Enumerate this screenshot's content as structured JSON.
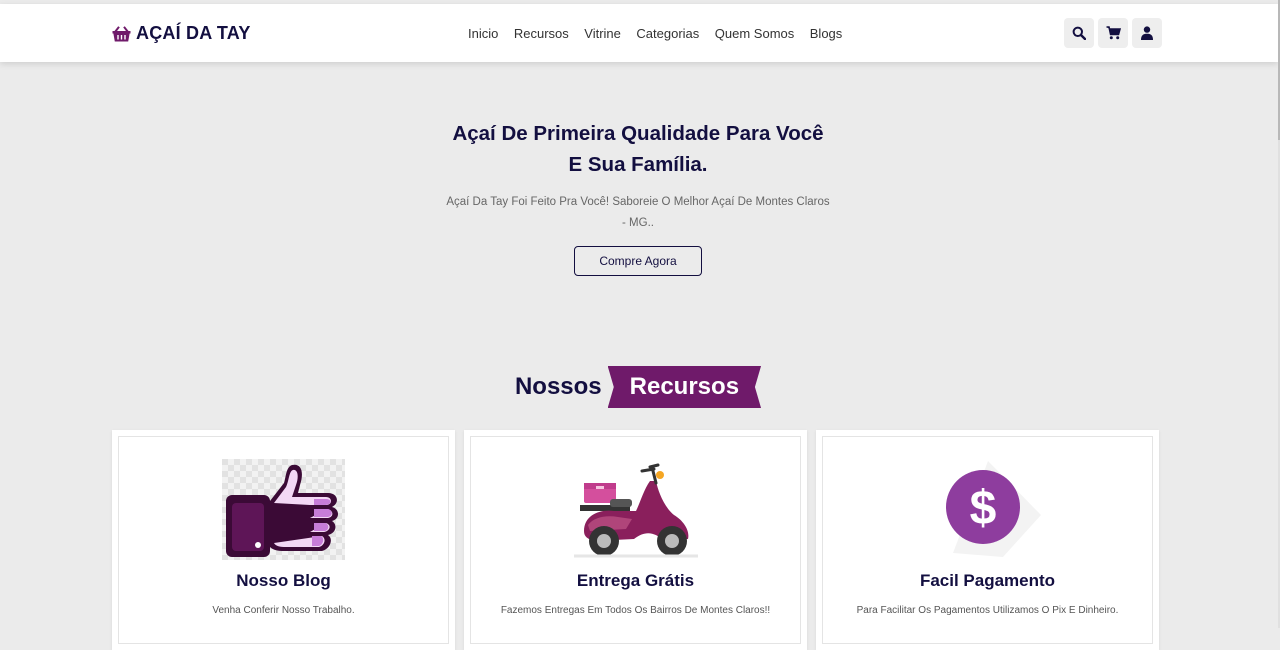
{
  "header": {
    "logo_text": "AÇAÍ DA TAY",
    "nav": [
      "Inicio",
      "Recursos",
      "Vitrine",
      "Categorias",
      "Quem Somos",
      "Blogs"
    ],
    "icons": [
      "search-icon",
      "cart-icon",
      "user-icon"
    ]
  },
  "hero": {
    "title_line1": "Açaí De Primeira Qualidade Para Você",
    "title_line2": "E Sua Família.",
    "subtitle": "Açaí Da Tay Foi Feito Pra Você! Saboreie O Melhor Açaí De Montes Claros - MG..",
    "cta": "Compre Agora"
  },
  "features": {
    "title_word1": "Nossos",
    "title_word2": "Recursos",
    "cards": [
      {
        "title": "Nosso Blog",
        "text": "Venha Conferir Nosso Trabalho.",
        "icon": "thumbs-up-icon"
      },
      {
        "title": "Entrega Grátis",
        "text": "Fazemos Entregas Em Todos Os Bairros De Montes Claros!!",
        "icon": "scooter-icon"
      },
      {
        "title": "Facil Pagamento",
        "text": "Para Facilitar Os Pagamentos Utilizamos O Pix E Dinheiro.",
        "icon": "dollar-icon"
      }
    ]
  },
  "colors": {
    "brand": "#130f40",
    "accent": "#6f1a6a",
    "background": "#ebebeb"
  }
}
